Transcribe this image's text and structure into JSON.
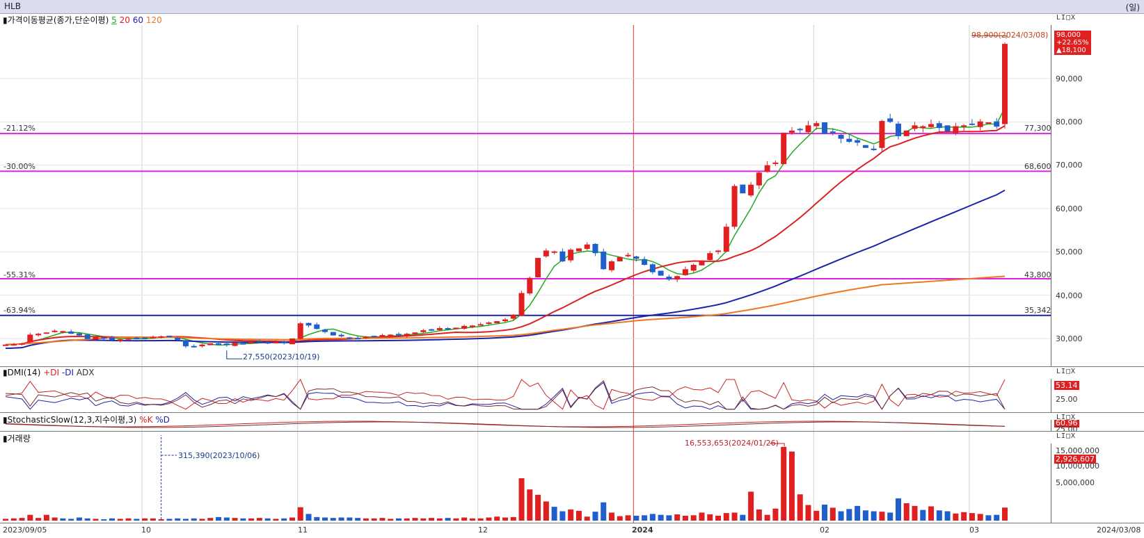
{
  "header": {
    "symbol": "HLB",
    "unit": "(일)"
  },
  "panels": {
    "price": {
      "title": "가격이동평균(종가,단순이평)",
      "ma_labels": [
        "5",
        "20",
        "60",
        "120"
      ]
    },
    "dmi": {
      "title": "DMI(14)",
      "plus_di": "+DI",
      "minus_di": "-DI",
      "adx": "ADX"
    },
    "stoch": {
      "title": "StochasticSlow(12,3,지수이평,3)",
      "k": "%K",
      "d": "%D"
    },
    "volume": {
      "title": "거래량"
    }
  },
  "colors": {
    "up": "#e02020",
    "down": "#1f5fcc",
    "ma5": "#22aa22",
    "ma20": "#dd2020",
    "ma60": "#1a23aa",
    "ma120": "#ee7722",
    "hline": "#e020e0",
    "baseline": "#1a23aa"
  },
  "price_axis": {
    "ticks": [
      "90,000",
      "80,000",
      "70,000",
      "60,000",
      "50,000",
      "40,000",
      "30,000"
    ]
  },
  "annotations": {
    "high": "98,900(2024/03/08)",
    "low": "27,550(2023/10/19)",
    "vol_low": "315,390(2023/10/06)",
    "vol_high": "16,553,653(2024/01/26)"
  },
  "levels": [
    {
      "pct": "-21.12%",
      "price": "77,300"
    },
    {
      "pct": "-30.00%",
      "price": "68,600"
    },
    {
      "pct": "-55.31%",
      "price": "43,800"
    },
    {
      "pct": "-63.94%",
      "price": "35,342"
    }
  ],
  "last_price": {
    "price": "98,000",
    "change_pct": "+22.65%",
    "change": "▲18,100"
  },
  "dmi_axis": {
    "tick": "25.00",
    "tag": "53.14"
  },
  "stoch_axis": {
    "tick": "25.00",
    "tag": "60.96"
  },
  "volume_axis": {
    "ticks": [
      "15,000,000",
      "10,000,000",
      "5,000,000"
    ],
    "tag": "2,926,607"
  },
  "x_axis": {
    "labels": [
      "2023/09/05",
      "10",
      "11",
      "12",
      "2024",
      "02",
      "03",
      "2024/03/08"
    ]
  },
  "panel_controls": "LI□X",
  "chart_data": {
    "type": "candlestick",
    "x": [
      "2023-09-05",
      "2023-09-06",
      "2023-09-07",
      "2023-09-08",
      "2023-09-11",
      "2023-09-12",
      "2023-09-13",
      "2023-09-14",
      "2023-09-15",
      "2023-09-18",
      "2023-09-19",
      "2023-09-20",
      "2023-09-21",
      "2023-09-22",
      "2023-09-25",
      "2023-09-26",
      "2023-09-27",
      "2023-10-04",
      "2023-10-05",
      "2023-10-06",
      "2023-10-10",
      "2023-10-11",
      "2023-10-12",
      "2023-10-13",
      "2023-10-16",
      "2023-10-17",
      "2023-10-18",
      "2023-10-19",
      "2023-10-20",
      "2023-10-23",
      "2023-10-24",
      "2023-10-25",
      "2023-10-26",
      "2023-10-27",
      "2023-10-30",
      "2023-10-31",
      "2023-11-01",
      "2023-11-02",
      "2023-11-03",
      "2023-11-06",
      "2023-11-07",
      "2023-11-08",
      "2023-11-09",
      "2023-11-10",
      "2023-11-13",
      "2023-11-14",
      "2023-11-15",
      "2023-11-16",
      "2023-11-17",
      "2023-11-20",
      "2023-11-21",
      "2023-11-22",
      "2023-11-23",
      "2023-11-24",
      "2023-11-27",
      "2023-11-28",
      "2023-11-29",
      "2023-11-30",
      "2023-12-01",
      "2023-12-04",
      "2023-12-05",
      "2023-12-06",
      "2023-12-07",
      "2023-12-08",
      "2023-12-11",
      "2023-12-12",
      "2023-12-13",
      "2023-12-14",
      "2023-12-15",
      "2023-12-18",
      "2023-12-19",
      "2023-12-20",
      "2023-12-21",
      "2023-12-22",
      "2023-12-26",
      "2023-12-27",
      "2023-12-28",
      "2024-01-02",
      "2024-01-03",
      "2024-01-04",
      "2024-01-05",
      "2024-01-08",
      "2024-01-09",
      "2024-01-10",
      "2024-01-11",
      "2024-01-12",
      "2024-01-15",
      "2024-01-16",
      "2024-01-17",
      "2024-01-18",
      "2024-01-19",
      "2024-01-22",
      "2024-01-23",
      "2024-01-24",
      "2024-01-25",
      "2024-01-26",
      "2024-01-29",
      "2024-01-30",
      "2024-01-31",
      "2024-02-01",
      "2024-02-02",
      "2024-02-05",
      "2024-02-06",
      "2024-02-07",
      "2024-02-08",
      "2024-02-13",
      "2024-02-14",
      "2024-02-15",
      "2024-02-16",
      "2024-02-19",
      "2024-02-20",
      "2024-02-21",
      "2024-02-22",
      "2024-02-23",
      "2024-02-26",
      "2024-02-27",
      "2024-02-28",
      "2024-02-29",
      "2024-03-04",
      "2024-03-05",
      "2024-03-06",
      "2024-03-07",
      "2024-03-08"
    ],
    "close": [
      28600,
      28700,
      28900,
      30900,
      31100,
      31400,
      31800,
      31700,
      31100,
      30700,
      29900,
      30300,
      30100,
      29600,
      29800,
      30100,
      30000,
      30200,
      30300,
      30500,
      30400,
      29700,
      28200,
      28000,
      28600,
      28900,
      28700,
      28500,
      29000,
      28900,
      29200,
      29300,
      29100,
      29200,
      28900,
      30000,
      33500,
      33000,
      32200,
      31500,
      30700,
      30500,
      30200,
      30100,
      30400,
      30600,
      30800,
      30900,
      30700,
      31100,
      31400,
      31900,
      32100,
      32400,
      32200,
      32500,
      32900,
      33000,
      33300,
      33700,
      34000,
      34400,
      35500,
      40500,
      44000,
      48600,
      50300,
      50100,
      47800,
      50500,
      50800,
      51700,
      49700,
      46000,
      47800,
      48800,
      49300,
      48400,
      47000,
      45300,
      44500,
      43600,
      44400,
      46000,
      47000,
      48000,
      49700,
      50300,
      55800,
      65200,
      63500,
      65500,
      68300,
      70000,
      70600,
      77500,
      78000,
      78200,
      79200,
      79700,
      77200,
      77400,
      76100,
      75400,
      75200,
      74000,
      73800,
      80200,
      80000,
      76700,
      78000,
      79200,
      79000,
      79500,
      78600,
      77800,
      79000,
      79200,
      79400,
      80100,
      79900,
      78900,
      98000
    ],
    "volume": [
      400000,
      500000,
      600000,
      1300000,
      600000,
      1300000,
      700000,
      500000,
      400000,
      700000,
      500000,
      400000,
      300000,
      500000,
      400000,
      500000,
      400000,
      500000,
      500000,
      315390,
      400000,
      500000,
      400000,
      500000,
      400000,
      600000,
      800000,
      700000,
      600000,
      500000,
      500000,
      600000,
      500000,
      400000,
      500000,
      700000,
      3000000,
      1500000,
      800000,
      700000,
      600000,
      700000,
      700000,
      600000,
      500000,
      500000,
      600000,
      400000,
      500000,
      500000,
      600000,
      500000,
      600000,
      500000,
      600000,
      500000,
      700000,
      500000,
      500000,
      700000,
      900000,
      700000,
      800000,
      9500000,
      7000000,
      5800000,
      4300000,
      3100000,
      2100000,
      2500000,
      2200000,
      900000,
      2000000,
      4100000,
      1800000,
      1000000,
      1200000,
      1100000,
      1200000,
      1500000,
      1300000,
      1200000,
      1400000,
      1100000,
      1200000,
      1800000,
      1400000,
      1100000,
      1700000,
      1800000,
      1300000,
      6500000,
      2500000,
      1300000,
      2700000,
      16553653,
      15500000,
      5900000,
      3500000,
      2200000,
      3600000,
      2900000,
      2100000,
      2600000,
      3300000,
      2300000,
      2100000,
      2000000,
      1800000,
      5000000,
      3900000,
      3300000,
      2400000,
      3200000,
      2300000,
      2100000,
      1600000,
      1900000,
      1700000,
      1500000,
      1200000,
      1300000,
      2926607
    ],
    "ma_periods": [
      5,
      20,
      60,
      120
    ],
    "levels": [
      77300,
      68600,
      43800,
      35342
    ],
    "level_pcts": [
      "-21.12%",
      "-30.00%",
      "-55.31%",
      "-63.94%"
    ],
    "high": {
      "value": 98900,
      "date": "2024-03-08"
    },
    "low": {
      "value": 27550,
      "date": "2023-10-19"
    },
    "last": {
      "value": 98000,
      "change_pct": 22.65,
      "change": 18100
    },
    "ylim": [
      23000,
      104000
    ],
    "dmi_last": 53.14,
    "stoch_last": 60.96,
    "grid": true
  }
}
